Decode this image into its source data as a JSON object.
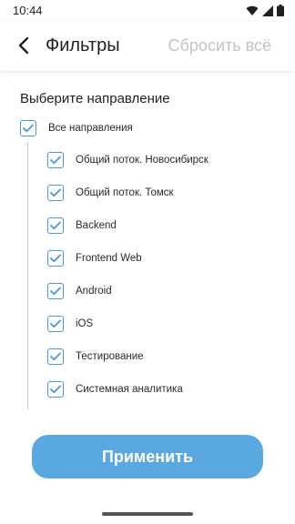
{
  "status_bar": {
    "time": "10:44",
    "icons": [
      "wifi-icon",
      "signal-icon",
      "battery-icon"
    ]
  },
  "header": {
    "back_icon": "chevron-left-icon",
    "title": "Фильтры",
    "reset_label": "Сбросить всё"
  },
  "section": {
    "title": "Выберите направление",
    "all_option": {
      "label": "Все направления",
      "checked": true
    },
    "options": [
      {
        "label": "Общий поток. Новосибирск",
        "checked": true
      },
      {
        "label": "Общий поток. Томск",
        "checked": true
      },
      {
        "label": "Backend",
        "checked": true
      },
      {
        "label": "Frontend Web",
        "checked": true
      },
      {
        "label": "Android",
        "checked": true
      },
      {
        "label": "iOS",
        "checked": true
      },
      {
        "label": "Тестирование",
        "checked": true
      },
      {
        "label": "Системная аналитика",
        "checked": true
      }
    ]
  },
  "footer": {
    "apply_label": "Применить"
  },
  "colors": {
    "accent": "#4a96dc",
    "button": "#5aa8e0",
    "reset_text": "#c4c4c4"
  }
}
